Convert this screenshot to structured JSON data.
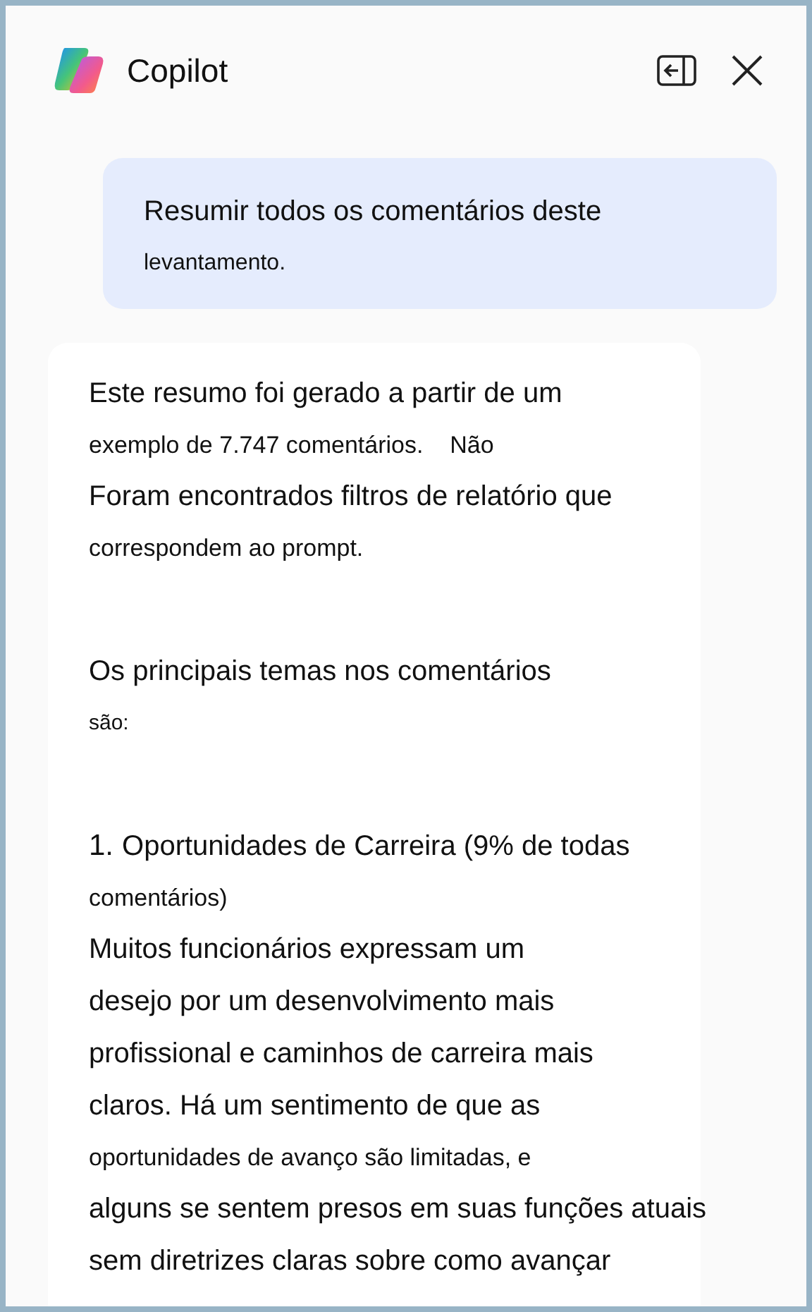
{
  "header": {
    "title": "Copilot"
  },
  "user_message": {
    "lines": [
      {
        "text": "Resumir todos os comentários deste",
        "kind": "large"
      },
      {
        "text": "levantamento.",
        "kind": "small"
      }
    ]
  },
  "response": {
    "paragraphs": [
      {
        "lines": [
          {
            "text": "Este resumo foi gerado a partir de um",
            "kind": "large"
          },
          {
            "text": "exemplo de 7.747 comentários.    Não",
            "kind": "medium"
          },
          {
            "text": "Foram encontrados filtros de relatório que",
            "kind": "large"
          },
          {
            "text": "correspondem ao prompt.",
            "kind": "medium"
          }
        ]
      },
      {
        "lines": [
          {
            "text": "Os principais temas nos comentários",
            "kind": "large"
          },
          {
            "text": "são:",
            "kind": "tiny"
          }
        ]
      },
      {
        "marker": "1.",
        "lines": [
          {
            "text": "Oportunidades de Carreira (9% de todas",
            "kind": "large"
          },
          {
            "text": "comentários)",
            "kind": "medium"
          },
          {
            "text": "Muitos funcionários expressam um",
            "kind": "large"
          },
          {
            "text": "desejo por um desenvolvimento mais",
            "kind": "large"
          },
          {
            "text": "profissional e caminhos de carreira mais",
            "kind": "large"
          },
          {
            "text": "claros. Há um sentimento de que as",
            "kind": "large"
          },
          {
            "text": "oportunidades de avanço são limitadas, e",
            "kind": "medium"
          },
          {
            "text": "alguns se sentem presos em suas funções atuais",
            "kind": "large"
          },
          {
            "text": "sem diretrizes claras sobre como avançar",
            "kind": "large"
          }
        ]
      }
    ]
  }
}
